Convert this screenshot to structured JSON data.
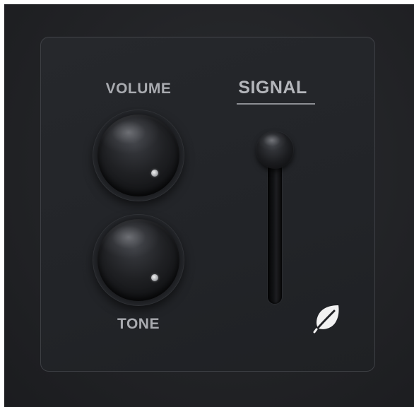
{
  "labels": {
    "volume": "VOLUME",
    "signal": "SIGNAL",
    "tone": "TONE"
  },
  "icons": {
    "leaf": "leaf-icon"
  },
  "colors": {
    "background": "#222326",
    "panel_border": "#3d3f44",
    "label": "#a9abb0",
    "leaf": "#f2f2f2"
  }
}
